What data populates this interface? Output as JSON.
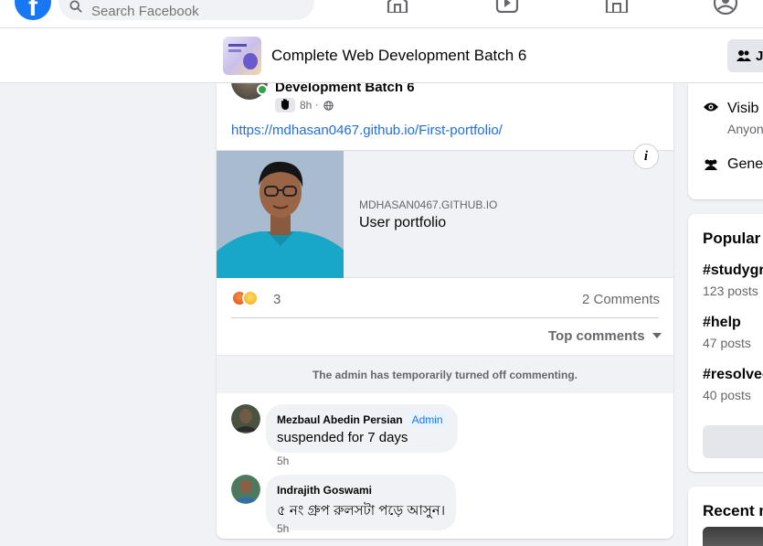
{
  "topnav": {
    "logo_letter": "f",
    "search_placeholder": "Search Facebook",
    "icons": [
      "home-icon",
      "watch-icon",
      "marketplace-icon",
      "profile-icon"
    ]
  },
  "group_bar": {
    "title": "Complete Web Development Batch 6",
    "join_label": "J"
  },
  "post": {
    "group_name": "Development Batch 6",
    "time": "8h",
    "dot": "·",
    "link": "https://mdhasan0467.github.io/First-portfolio/",
    "preview": {
      "domain": "MDHASAN0467.GITHUB.IO",
      "title": "User portfolio",
      "info_glyph": "i"
    },
    "reaction_count": "3",
    "comments_count": "2 Comments",
    "sort_label": "Top comments",
    "notice": "The admin has temporarily turned off commenting."
  },
  "comments": [
    {
      "name": "Mezbaul Abedin Persian",
      "badge": "Admin",
      "text": "suspended for 7 days",
      "time": "5h"
    },
    {
      "name": "Indrajith Goswami",
      "text": "৫ নং গ্রুপ রুলসটা পড়ে আসুন।",
      "time": "5h"
    }
  ],
  "sidebar": {
    "about": {
      "visibility_title": "Visib",
      "visibility_sub": "Anyon",
      "general": "Gene"
    },
    "popular": {
      "title": "Popular t",
      "tags": [
        {
          "tag": "#studygr",
          "count": "123 posts"
        },
        {
          "tag": "#help",
          "count": "47 posts"
        },
        {
          "tag": "#resolved",
          "count": "40 posts"
        }
      ]
    },
    "recent": {
      "title": "Recent m"
    }
  },
  "colors": {
    "brand": "#1877f2",
    "link": "#216fdb",
    "online": "#31a24c",
    "background": "#f0f2f5"
  }
}
